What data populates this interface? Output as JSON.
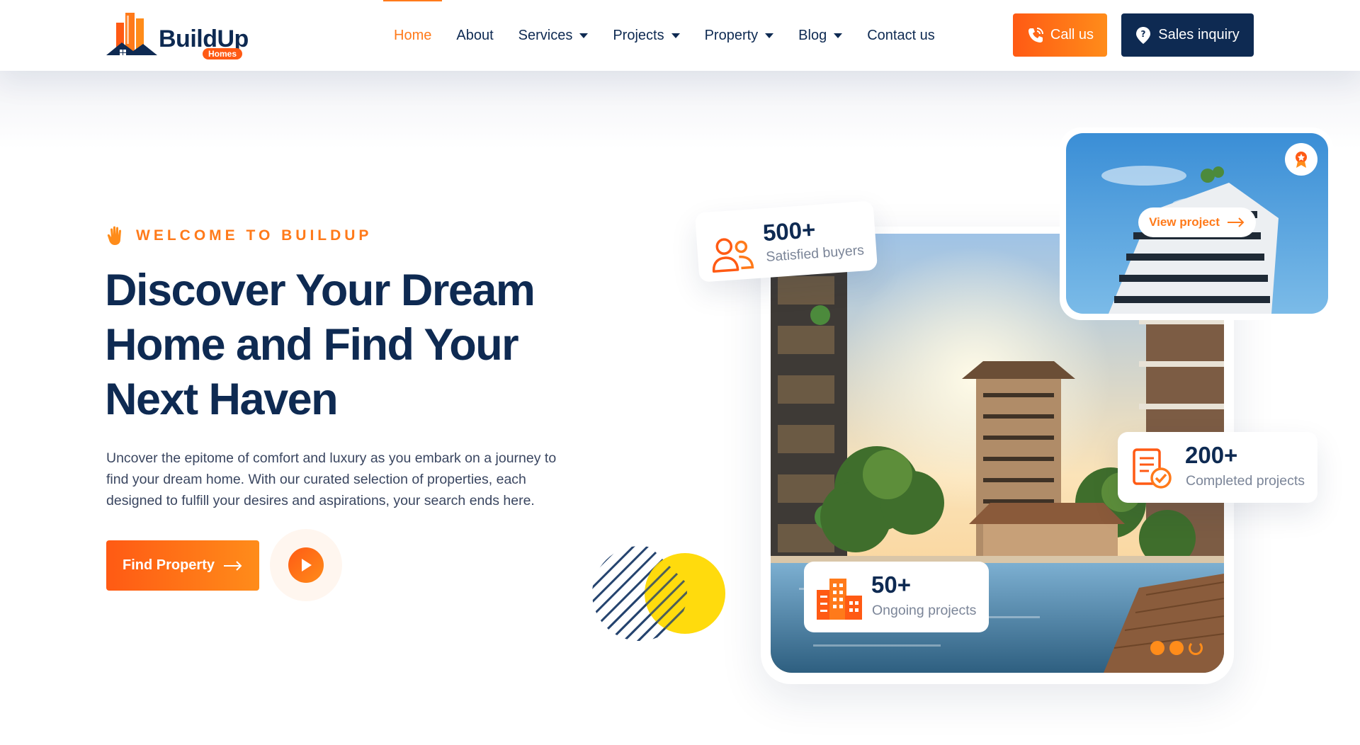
{
  "brand": {
    "name": "BuildUp",
    "badge": "Homes"
  },
  "nav": {
    "items": [
      {
        "label": "Home",
        "active": true,
        "dropdown": false
      },
      {
        "label": "About",
        "active": false,
        "dropdown": false
      },
      {
        "label": "Services",
        "active": false,
        "dropdown": true
      },
      {
        "label": "Projects",
        "active": false,
        "dropdown": true
      },
      {
        "label": "Property",
        "active": false,
        "dropdown": true
      },
      {
        "label": "Blog",
        "active": false,
        "dropdown": true
      },
      {
        "label": "Contact us",
        "active": false,
        "dropdown": false
      }
    ]
  },
  "header": {
    "call_label": "Call us",
    "sales_label": "Sales inquiry"
  },
  "hero": {
    "welcome": "WELCOME TO BUILDUP",
    "title_lines": [
      "Discover Your Dream",
      "Home and Find Your",
      "Next Haven"
    ],
    "description": "Uncover the epitome of comfort and luxury as you embark on a journey to find your dream home. With our curated selection of properties, each designed to fulfill your desires and aspirations, your search ends here.",
    "cta_label": "Find Property"
  },
  "stats": {
    "buyers": {
      "value": "500+",
      "label": "Satisfied buyers"
    },
    "completed": {
      "value": "200+",
      "label": "Completed projects"
    },
    "ongoing": {
      "value": "50+",
      "label": "Ongoing projects"
    }
  },
  "featured": {
    "view_label": "View project"
  },
  "icons": [
    "wave-hand-icon",
    "phone-icon",
    "location-pin-icon",
    "arrow-right-icon",
    "play-icon",
    "users-icon",
    "checklist-icon",
    "buildings-icon",
    "award-icon"
  ],
  "colors": {
    "primary": "#0e2a52",
    "accent": "#ff7a1a",
    "accent_start": "#ff5a14",
    "yellow": "#ffd900"
  },
  "slider": {
    "total_slides": 3
  }
}
